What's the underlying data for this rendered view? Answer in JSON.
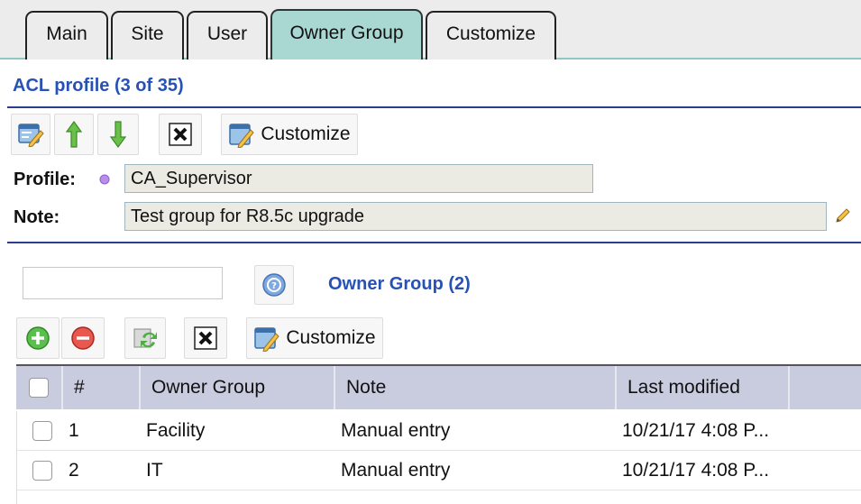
{
  "tabs": [
    {
      "label": "Main",
      "active": false
    },
    {
      "label": "Site",
      "active": false
    },
    {
      "label": "User",
      "active": false
    },
    {
      "label": "Owner Group",
      "active": true
    },
    {
      "label": "Customize",
      "active": false
    }
  ],
  "acl": {
    "title": "ACL profile (3 of 35)",
    "toolbar": {
      "customize_label": "Customize"
    }
  },
  "profile": {
    "label": "Profile:",
    "value": "CA_Supervisor",
    "note_label": "Note:",
    "note_value": "Test group for R8.5c upgrade"
  },
  "owner_group": {
    "search_value": "",
    "title": "Owner Group (2)",
    "toolbar": {
      "customize_label": "Customize"
    },
    "columns": [
      "#",
      "Owner Group",
      "Note",
      "Last modified"
    ],
    "rows": [
      {
        "num": "1",
        "owner_group": "Facility",
        "note": "Manual entry",
        "last_modified": "10/21/17 4:08 P..."
      },
      {
        "num": "2",
        "owner_group": "IT",
        "note": "Manual entry",
        "last_modified": "10/21/17 4:08 P..."
      }
    ]
  },
  "colors": {
    "accent_blue": "#2752b5",
    "active_tab": "#a9d8d3",
    "header_bg": "#c9cbdf",
    "field_bg": "#ebebe3"
  }
}
